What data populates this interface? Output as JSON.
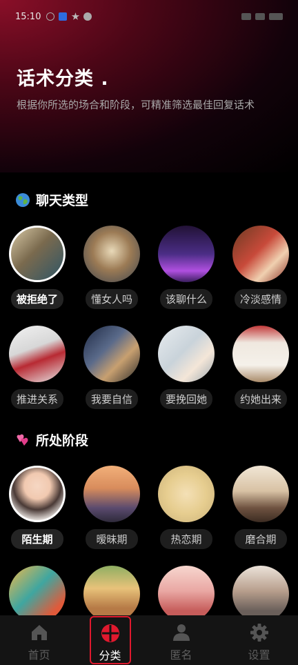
{
  "status": {
    "time": "15:10"
  },
  "header": {
    "title": "话术分类 .",
    "subtitle": "根据你所选的场合和阶段，可精准筛选最佳回复话术"
  },
  "sections": {
    "chat_types": {
      "title": "聊天类型",
      "icon": "globe-icon",
      "items": [
        {
          "label": "被拒绝了",
          "selected": true
        },
        {
          "label": "懂女人吗",
          "selected": false
        },
        {
          "label": "该聊什么",
          "selected": false
        },
        {
          "label": "冷淡感情",
          "selected": false
        },
        {
          "label": "推进关系",
          "selected": false
        },
        {
          "label": "我要自信",
          "selected": false
        },
        {
          "label": "要挽回她",
          "selected": false
        },
        {
          "label": "约她出来",
          "selected": false
        }
      ]
    },
    "stages": {
      "title": "所处阶段",
      "icon": "hearts-icon",
      "items": [
        {
          "label": "陌生期",
          "selected": true
        },
        {
          "label": "暧昧期",
          "selected": false
        },
        {
          "label": "热恋期",
          "selected": false
        },
        {
          "label": "磨合期",
          "selected": false
        }
      ]
    }
  },
  "tabbar": {
    "items": [
      {
        "label": "首页",
        "icon": "home-icon",
        "active": false
      },
      {
        "label": "分类",
        "icon": "category-icon",
        "active": true
      },
      {
        "label": "匿名",
        "icon": "person-icon",
        "active": false
      },
      {
        "label": "设置",
        "icon": "gear-icon",
        "active": false
      }
    ]
  },
  "colors": {
    "accent": "#e0192e",
    "background": "#000000"
  }
}
